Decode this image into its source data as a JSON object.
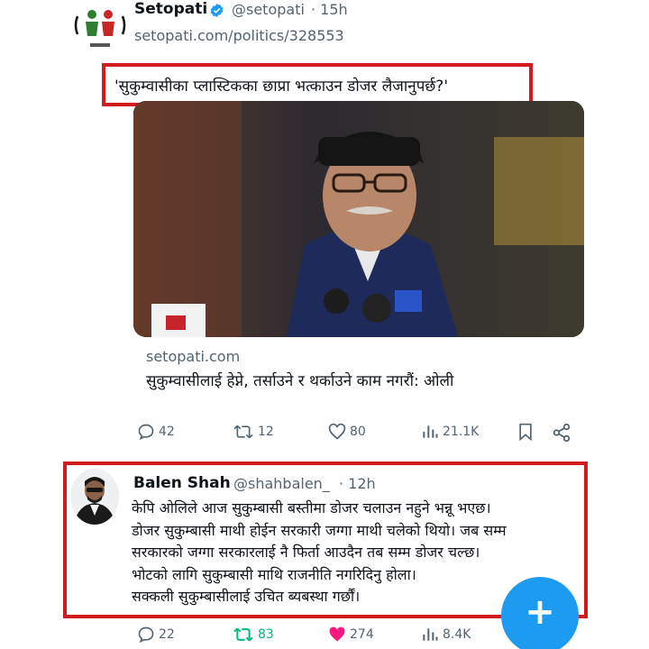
{
  "tweet1": {
    "display_name": "Setopati",
    "handle": "@setopati",
    "time": "· 15h",
    "link": "setopati.com/politics/328553",
    "quote": "'सुकुम्वासीका प्लास्टिकका छाप्रा भत्काउन डोजर लैजानुपर्छ?'",
    "card_domain": "setopati.com",
    "card_title": "सुकुम्वासीलाई हेप्ने, तर्साउने र थर्काउने काम नगरौं: ओली",
    "actions": {
      "replies": "42",
      "retweets": "12",
      "likes": "80",
      "views": "21.1K"
    }
  },
  "tweet2": {
    "display_name": "Balen Shah",
    "handle": "@shahbalen_",
    "time": "· 12h",
    "body_lines": [
      "केपि ओलिले आज सुकुम्बासी बस्तीमा डोजर चलाउन नहुने भन्नू भएछ।",
      "डोजर सुकुम्बासी माथी होईन सरकारी जग्गा माथी चलेको थियो। जब सम्म",
      "सरकारको जग्गा सरकारलाई नै फिर्ता आउदैन तब सम्म डोजर चल्छ।",
      "भोटको लागि सुकुम्बासी माथि राजनीति नगरिदिनु होला।",
      "सक्कली सुकुम्बासीलाई उचित ब्यबस्था गर्छौं।"
    ],
    "actions": {
      "replies": "22",
      "retweets": "83",
      "likes": "274",
      "views": "8.4K"
    }
  },
  "fab": {
    "label": "+"
  },
  "colors": {
    "highlight": "#d01c1f",
    "accent": "#1d9bf0",
    "like": "#f91880",
    "muted": "#536471"
  },
  "icons": [
    "reply-icon",
    "retweet-icon",
    "like-icon",
    "views-icon",
    "bookmark-icon",
    "share-icon",
    "verified-badge-icon"
  ]
}
